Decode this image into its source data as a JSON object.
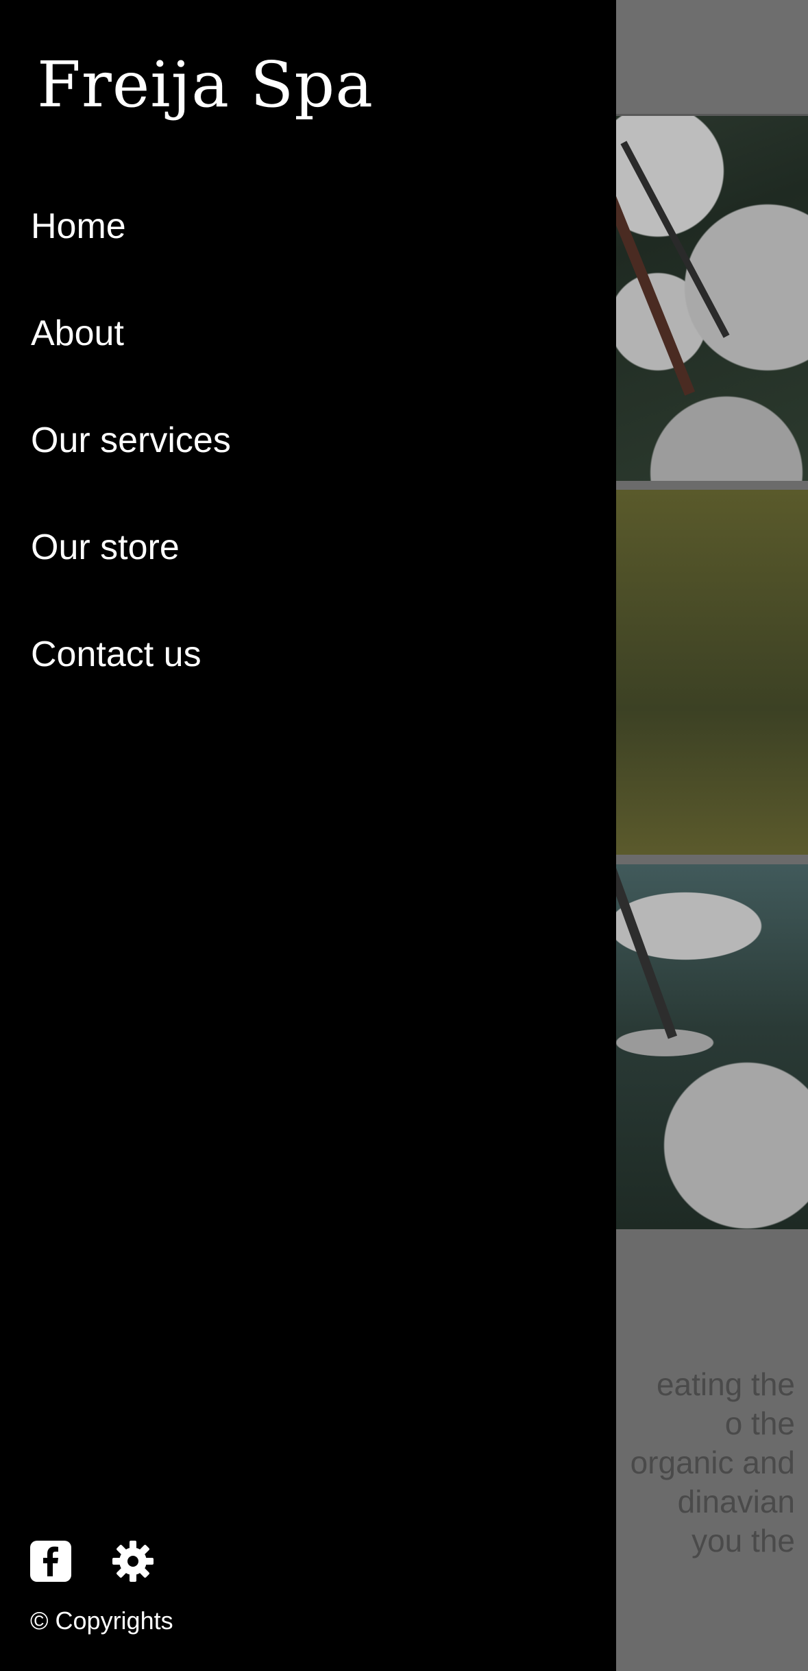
{
  "app": {
    "brand": "Freija Spa"
  },
  "drawer": {
    "items": [
      {
        "label": "Home"
      },
      {
        "label": "About"
      },
      {
        "label": "Our services"
      },
      {
        "label": "Our store"
      },
      {
        "label": "Contact us"
      }
    ],
    "footer": {
      "icons": [
        "facebook-icon",
        "gear-icon"
      ],
      "copyright": "© Copyrights"
    }
  },
  "background": {
    "text_lines": [
      "eating the",
      "o the",
      "organic and",
      "dinavian",
      "you the"
    ]
  },
  "colors": {
    "drawer_bg": "#000000",
    "drawer_text": "#ffffff",
    "overlay": "#6b6b6b"
  }
}
